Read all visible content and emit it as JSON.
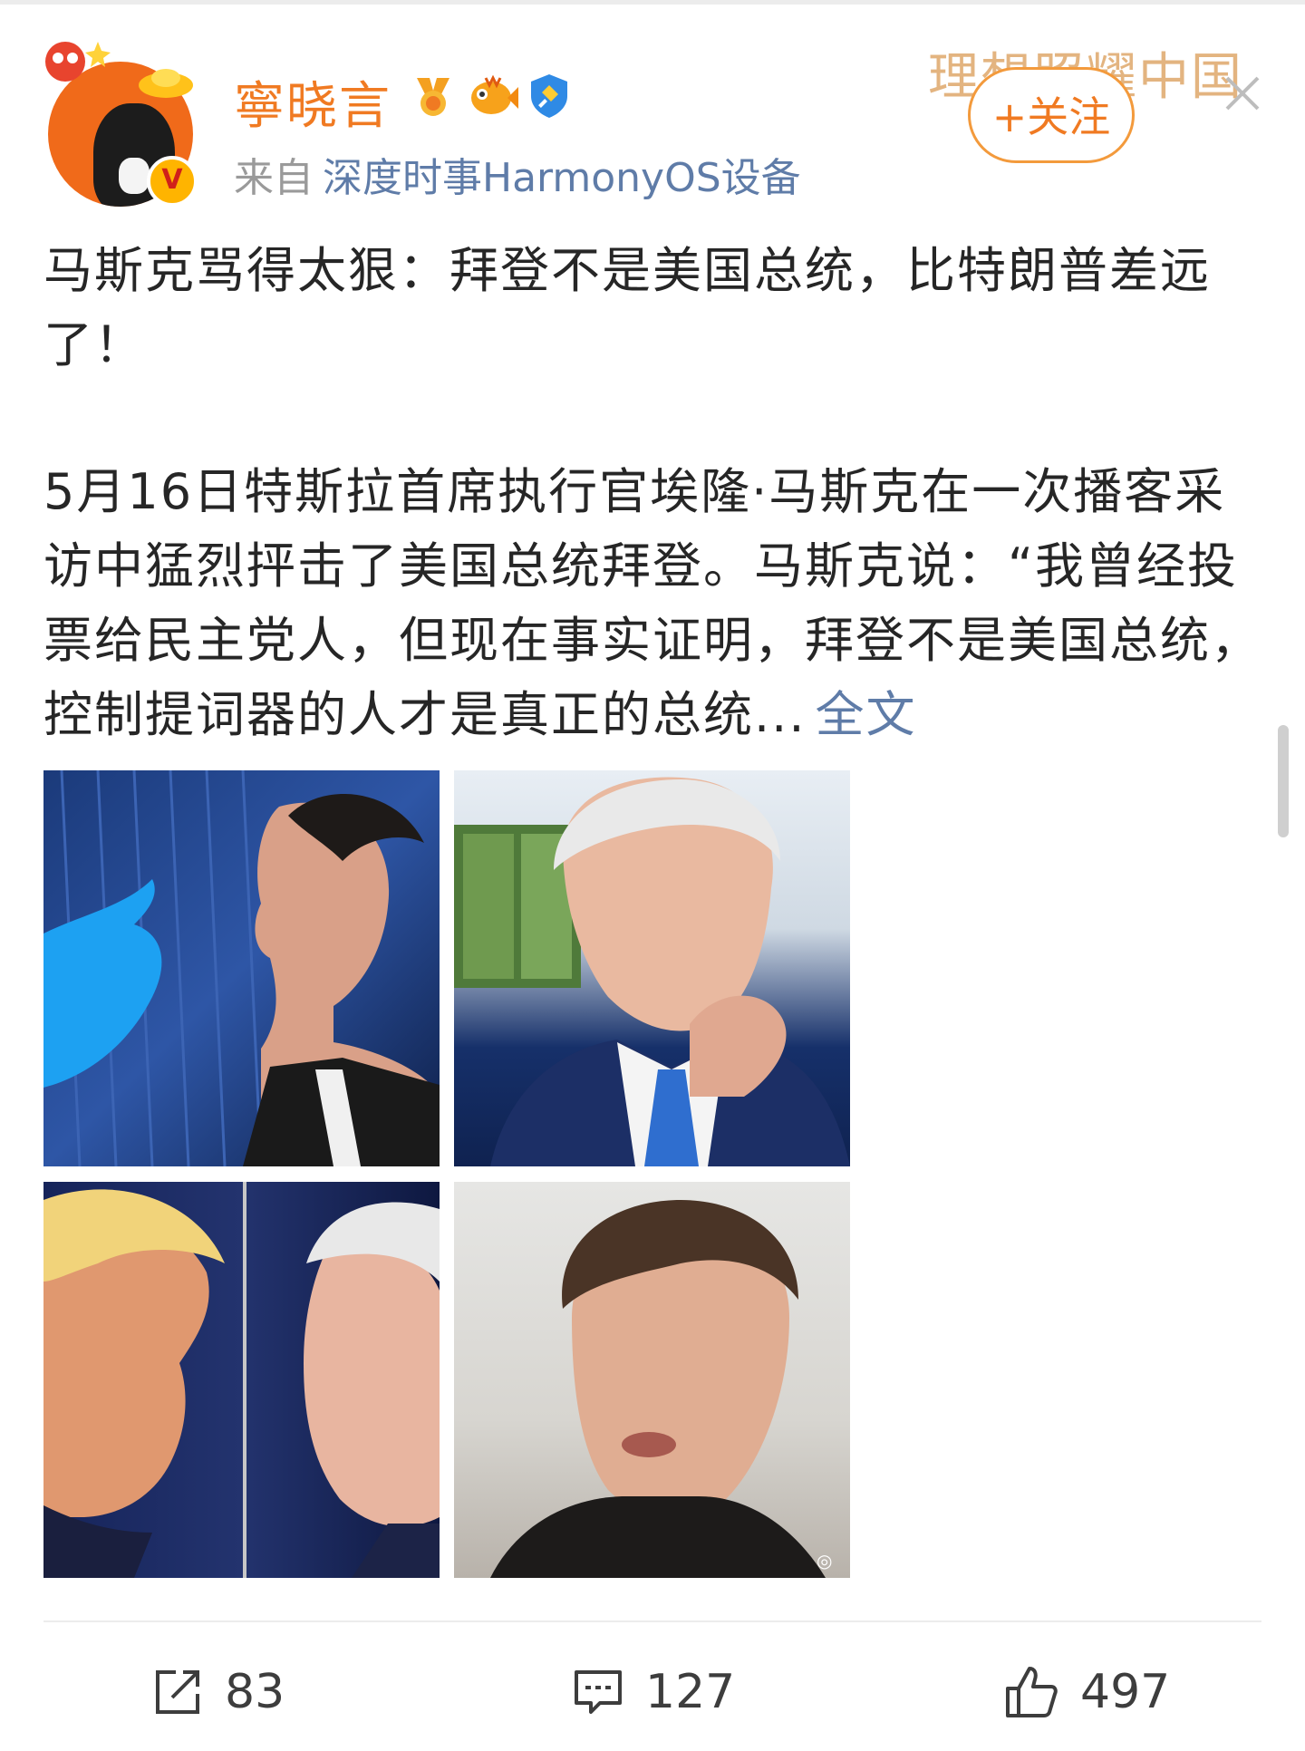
{
  "user": {
    "name": "寧晓言",
    "verified_badge": "V",
    "badges": [
      "medal-badge-icon",
      "fish-badge-icon",
      "shield-badge-icon"
    ]
  },
  "source": {
    "prefix": "来自",
    "device": "深度时事HarmonyOS设备"
  },
  "watermark": "理想照耀中国",
  "follow_button": "+关注",
  "post": {
    "title": "马斯克骂得太狠：拜登不是美国总统，比特朗普差远了！",
    "body": "5月16日特斯拉首席执行官埃隆·马斯克在一次播客采访中猛烈抨击了美国总统拜登。马斯克说：“我曾经投票给民主党人，但现在事实证明，拜登不是美国总统，控制提词器的人才是真正的总统...",
    "more_link": "全文"
  },
  "images": [
    {
      "name": "photo-musk-twitter-logo"
    },
    {
      "name": "photo-biden"
    },
    {
      "name": "photo-trump-biden"
    },
    {
      "name": "photo-musk-video"
    }
  ],
  "actions": {
    "repost_count": "83",
    "comment_count": "127",
    "like_count": "497"
  },
  "colors": {
    "accent": "#f07a22",
    "link": "#5f7ca8",
    "watermark": "#e3b480"
  }
}
